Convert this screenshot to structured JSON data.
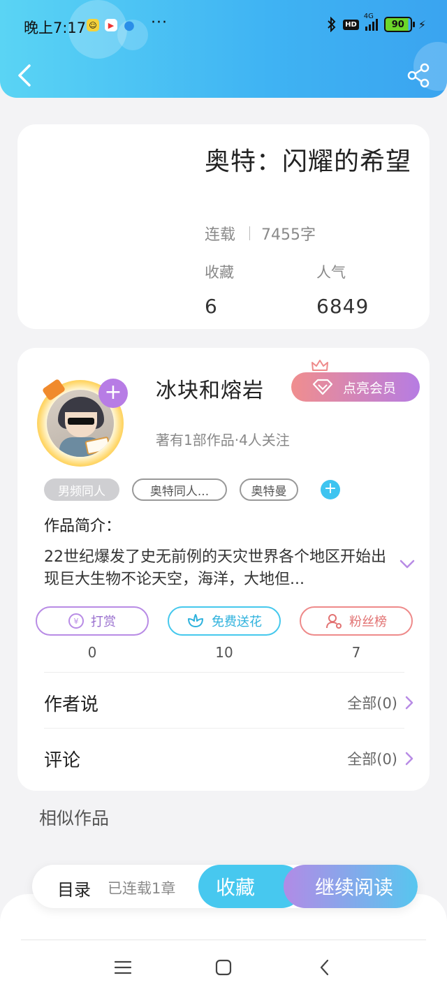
{
  "status_bar": {
    "time": "晚上7:17",
    "more": "···",
    "hd": "HD",
    "network": "4G",
    "battery": "90",
    "app_icons": [
      "wechat-icon",
      "video-app-icon",
      "drop-icon"
    ]
  },
  "book": {
    "title": "奥特：闪耀的希望",
    "status": "连载",
    "word_count": "7455字",
    "favorites_label": "收藏",
    "favorites_value": "6",
    "popularity_label": "人气",
    "popularity_value": "6849"
  },
  "author": {
    "name": "冰块和熔岩",
    "vip_label": "点亮会员",
    "sub": "著有1部作品·4人关注",
    "tags": [
      "男频同人",
      "奥特同人...",
      "奥特曼"
    ]
  },
  "intro": {
    "title": "作品简介：",
    "text": "22世纪爆发了史无前例的天灾世界各个地区开始出现巨大生物不论天空，海洋，大地但..."
  },
  "actions": [
    {
      "label": "打赏",
      "count": "0"
    },
    {
      "label": "免费送花",
      "count": "10"
    },
    {
      "label": "粉丝榜",
      "count": "7"
    }
  ],
  "rows": {
    "author_says": {
      "title": "作者说",
      "right": "全部(0)"
    },
    "comments": {
      "title": "评论",
      "right": "全部(0)"
    }
  },
  "similar_title": "相似作品",
  "bottom_bar": {
    "toc": "目录",
    "progress": "已连载1章",
    "favorite": "收藏",
    "continue": "继续阅读"
  },
  "colors": {
    "header_start": "#5ad4f4",
    "header_end": "#3aa4f0",
    "accent_purple": "#b77ce5",
    "accent_cyan": "#47c8ef",
    "accent_pink": "#ee8a8a"
  }
}
